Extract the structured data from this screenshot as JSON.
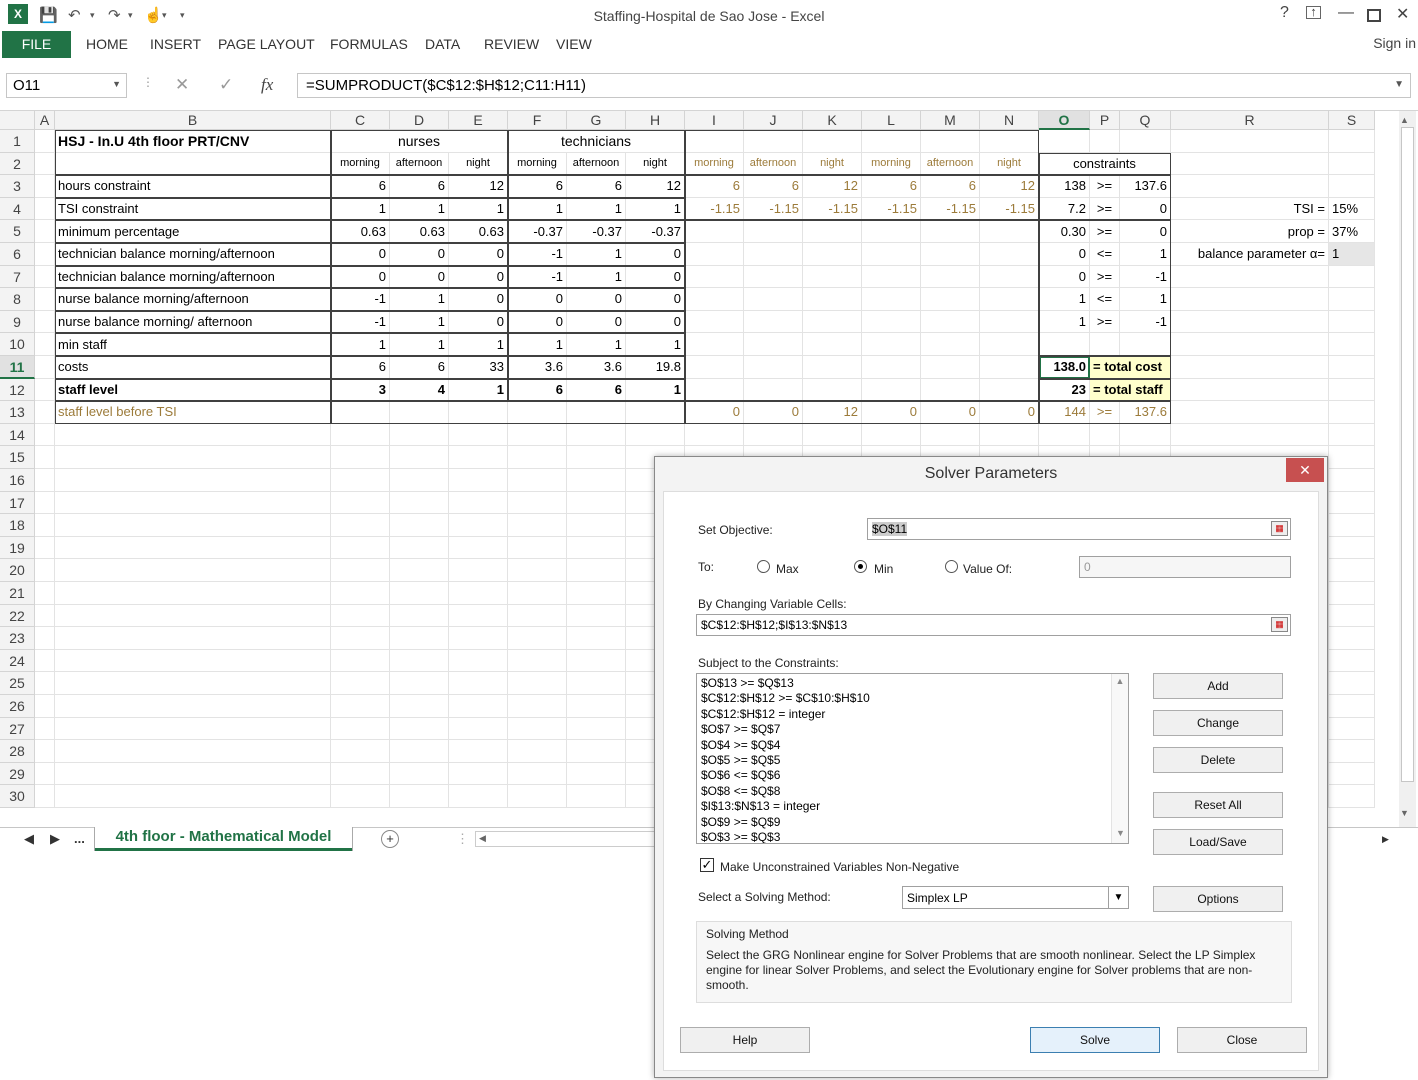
{
  "window": {
    "title": "Staffing-Hospital de Sao Jose - Excel",
    "help": "?",
    "sign_in": "Sign in"
  },
  "ribbon": {
    "file": "FILE",
    "tabs": [
      "HOME",
      "INSERT",
      "PAGE LAYOUT",
      "FORMULAS",
      "DATA",
      "REVIEW",
      "VIEW"
    ]
  },
  "formula_bar": {
    "name_box": "O11",
    "formula": "=SUMPRODUCT($C$12:$H$12;C11:H11)",
    "fx": "fx"
  },
  "columns": [
    "A",
    "B",
    "C",
    "D",
    "E",
    "F",
    "G",
    "H",
    "I",
    "J",
    "K",
    "L",
    "M",
    "N",
    "O",
    "P",
    "Q",
    "R",
    "S"
  ],
  "rows": [
    "1",
    "2",
    "3",
    "4",
    "5",
    "6",
    "7",
    "8",
    "9",
    "10",
    "11",
    "12",
    "13",
    "14",
    "15",
    "16",
    "17",
    "18",
    "19",
    "20",
    "21",
    "22",
    "23",
    "24",
    "25",
    "26",
    "27",
    "28",
    "29",
    "30"
  ],
  "sheet": {
    "title": "HSJ - In.U 4th floor PRT/CNV",
    "group_nurses": "nurses",
    "group_technicians": "technicians",
    "shift_labels": [
      "morning",
      "afternoon",
      "night",
      "morning",
      "afternoon",
      "night",
      "morning",
      "afternoon",
      "night",
      "morning",
      "afternoon",
      "night"
    ],
    "constraints_header": "constraints",
    "table": [
      {
        "label": "hours constraint",
        "vals": [
          "6",
          "6",
          "12",
          "6",
          "6",
          "12"
        ],
        "ext": [
          "6",
          "6",
          "12",
          "6",
          "6",
          "12"
        ],
        "o": "138",
        "p": ">=",
        "q": "137.6"
      },
      {
        "label": "TSI constraint",
        "vals": [
          "1",
          "1",
          "1",
          "1",
          "1",
          "1"
        ],
        "ext": [
          "-1.15",
          "-1.15",
          "-1.15",
          "-1.15",
          "-1.15",
          "-1.15"
        ],
        "o": "7.2",
        "p": ">=",
        "q": "0"
      },
      {
        "label": "minimum percentage",
        "vals": [
          "0.63",
          "0.63",
          "0.63",
          "-0.37",
          "-0.37",
          "-0.37"
        ],
        "ext": [
          "",
          "",
          "",
          "",
          "",
          ""
        ],
        "o": "0.30",
        "p": ">=",
        "q": "0"
      },
      {
        "label": "technician balance morning/afternoon",
        "vals": [
          "0",
          "0",
          "0",
          "-1",
          "1",
          "0"
        ],
        "ext": [
          "",
          "",
          "",
          "",
          "",
          ""
        ],
        "o": "0",
        "p": "<=",
        "q": "1"
      },
      {
        "label": "technician balance morning/afternoon",
        "vals": [
          "0",
          "0",
          "0",
          "-1",
          "1",
          "0"
        ],
        "ext": [
          "",
          "",
          "",
          "",
          "",
          ""
        ],
        "o": "0",
        "p": ">=",
        "q": "-1"
      },
      {
        "label": "nurse balance morning/afternoon",
        "vals": [
          "-1",
          "1",
          "0",
          "0",
          "0",
          "0"
        ],
        "ext": [
          "",
          "",
          "",
          "",
          "",
          ""
        ],
        "o": "1",
        "p": "<=",
        "q": "1"
      },
      {
        "label": "nurse balance morning/ afternoon",
        "vals": [
          "-1",
          "1",
          "0",
          "0",
          "0",
          "0"
        ],
        "ext": [
          "",
          "",
          "",
          "",
          "",
          ""
        ],
        "o": "1",
        "p": ">=",
        "q": "-1"
      },
      {
        "label": "min staff",
        "vals": [
          "1",
          "1",
          "1",
          "1",
          "1",
          "1"
        ],
        "ext": [
          "",
          "",
          "",
          "",
          "",
          ""
        ],
        "o": "",
        "p": "",
        "q": ""
      },
      {
        "label": "costs",
        "vals": [
          "6",
          "6",
          "33",
          "3.6",
          "3.6",
          "19.8"
        ],
        "ext": [
          "",
          "",
          "",
          "",
          "",
          ""
        ],
        "o": "138.0",
        "p": "= total cost",
        "q": ""
      },
      {
        "label": "staff level",
        "vals": [
          "3",
          "4",
          "1",
          "6",
          "6",
          "1"
        ],
        "ext": [
          "",
          "",
          "",
          "",
          "",
          ""
        ],
        "o": "23",
        "p": "= total staff",
        "q": ""
      },
      {
        "label": "staff level before TSI",
        "vals": [
          "",
          "",
          "",
          "",
          "",
          ""
        ],
        "ext": [
          "0",
          "0",
          "12",
          "0",
          "0",
          "0"
        ],
        "o": "144",
        "p": ">=",
        "q": "137.6"
      }
    ],
    "params": [
      {
        "label": "TSI =",
        "value": "15%"
      },
      {
        "label": "prop =",
        "value": "37%"
      },
      {
        "label": "balance parameter α=",
        "value": "1"
      }
    ]
  },
  "sheet_tabs": {
    "more": "...",
    "active": "4th floor - Mathematical Model",
    "add": "+"
  },
  "dialog": {
    "title": "Solver Parameters",
    "set_objective_label": "Set Objective:",
    "objective": "$O$11",
    "to_label": "To:",
    "max": "Max",
    "min": "Min",
    "value_of": "Value Of:",
    "value_of_value": "0",
    "changing_label": "By Changing Variable Cells:",
    "changing": "$C$12:$H$12;$I$13:$N$13",
    "constraints_label": "Subject to the Constraints:",
    "constraints": [
      "$O$13 >= $Q$13",
      "$C$12:$H$12 >= $C$10:$H$10",
      "$C$12:$H$12 = integer",
      "$O$7 >= $Q$7",
      "$O$4 >= $Q$4",
      "$O$5 >= $Q$5",
      "$O$6 <= $Q$6",
      "$O$8 <= $Q$8",
      "$I$13:$N$13 = integer",
      "$O$9 >= $Q$9",
      "$O$3 >= $Q$3"
    ],
    "add": "Add",
    "change": "Change",
    "delete": "Delete",
    "reset_all": "Reset All",
    "load_save": "Load/Save",
    "nonneg": "Make Unconstrained Variables Non-Negative",
    "method_label": "Select a Solving Method:",
    "method": "Simplex LP",
    "options": "Options",
    "group_title": "Solving Method",
    "group_text": "Select the GRG Nonlinear engine for Solver Problems that are smooth nonlinear. Select the LP Simplex engine for linear Solver Problems, and select the Evolutionary engine for Solver problems that are non-smooth.",
    "help": "Help",
    "solve": "Solve",
    "close": "Close"
  },
  "colors": {
    "excel_green": "#217346",
    "highlight_yellow": "#ffffcc",
    "gold_text": "#9c7b3a",
    "close_red": "#c75050"
  }
}
